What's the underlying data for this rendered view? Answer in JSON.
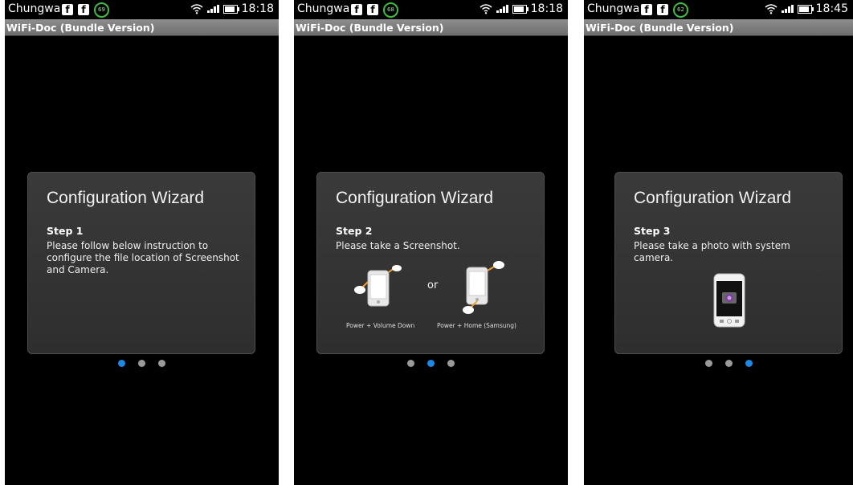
{
  "screens": [
    {
      "status": {
        "carrier": "Chungwa",
        "badge": "69",
        "time": "18:18"
      },
      "app_title": "WiFi-Doc (Bundle Version)",
      "card": {
        "title": "Configuration Wizard",
        "step": "Step 1",
        "description": "Please follow below instruction to configure the file location of Screenshot and Camera."
      },
      "active_page": 1
    },
    {
      "status": {
        "carrier": "Chungwa",
        "badge": "68",
        "time": "18:18"
      },
      "app_title": "WiFi-Doc (Bundle Version)",
      "card": {
        "title": "Configuration Wizard",
        "step": "Step 2",
        "description": "Please take a Screenshot.",
        "or_label": "or",
        "option1_label": "Power + Volume Down",
        "option2_label": "Power + Home (Samsung)"
      },
      "active_page": 2
    },
    {
      "status": {
        "carrier": "Chungwa",
        "badge": "62",
        "time": "18:45"
      },
      "app_title": "WiFi-Doc (Bundle Version)",
      "card": {
        "title": "Configuration Wizard",
        "step": "Step 3",
        "description": "Please take a photo with system camera."
      },
      "active_page": 3
    }
  ],
  "colors": {
    "active_dot": "#1e88e5",
    "inactive_dot": "#9a9a9a",
    "badge_ring": "#3fbf3f"
  }
}
